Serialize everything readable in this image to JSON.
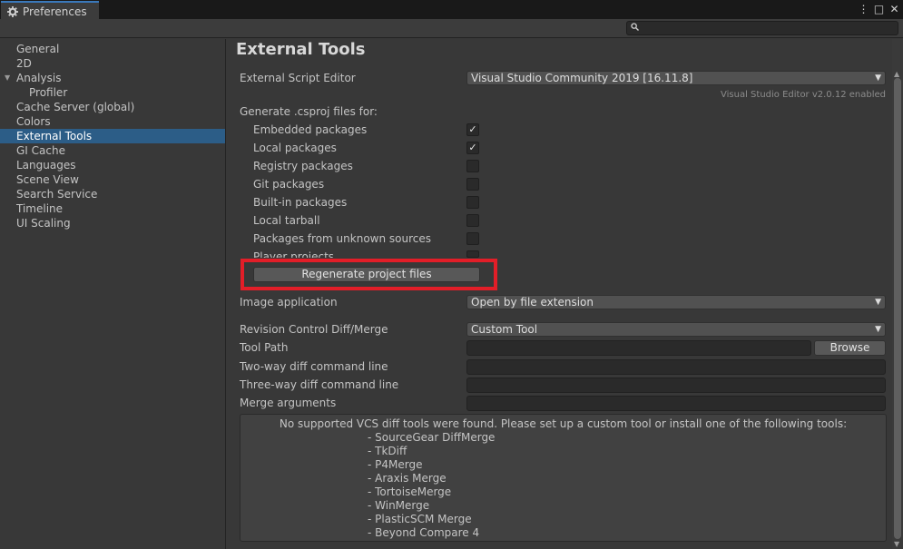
{
  "window": {
    "title": "Preferences",
    "controls": [
      "⋮",
      "□",
      "✕"
    ]
  },
  "search": {
    "placeholder": ""
  },
  "sidebar": {
    "items": [
      {
        "label": "General"
      },
      {
        "label": "2D"
      },
      {
        "label": "Analysis"
      },
      {
        "label": "Profiler"
      },
      {
        "label": "Cache Server (global)"
      },
      {
        "label": "Colors"
      },
      {
        "label": "External Tools"
      },
      {
        "label": "GI Cache"
      },
      {
        "label": "Languages"
      },
      {
        "label": "Scene View"
      },
      {
        "label": "Search Service"
      },
      {
        "label": "Timeline"
      },
      {
        "label": "UI Scaling"
      }
    ],
    "selected": "External Tools"
  },
  "main": {
    "title": "External Tools",
    "script_editor": {
      "label": "External Script Editor",
      "value": "Visual Studio Community 2019 [16.11.8]",
      "hint": "Visual Studio Editor v2.0.12 enabled"
    },
    "csproj": {
      "heading": "Generate .csproj files for:",
      "items": [
        {
          "label": "Embedded packages",
          "checked": true,
          "mark": "✓"
        },
        {
          "label": "Local packages",
          "checked": true,
          "mark": "✓"
        },
        {
          "label": "Registry packages",
          "checked": false,
          "mark": ""
        },
        {
          "label": "Git packages",
          "checked": false,
          "mark": ""
        },
        {
          "label": "Built-in packages",
          "checked": false,
          "mark": ""
        },
        {
          "label": "Local tarball",
          "checked": false,
          "mark": ""
        },
        {
          "label": "Packages from unknown sources",
          "checked": false,
          "mark": ""
        },
        {
          "label": "Player projects",
          "checked": false,
          "mark": ""
        }
      ],
      "regenerate_label": "Regenerate project files"
    },
    "image_app": {
      "label": "Image application",
      "value": "Open by file extension"
    },
    "revision": {
      "label": "Revision Control Diff/Merge",
      "value": "Custom Tool"
    },
    "tool_path": {
      "label": "Tool Path",
      "value": "",
      "browse_label": "Browse"
    },
    "two_way": {
      "label": "Two-way diff command line",
      "value": ""
    },
    "three_way": {
      "label": "Three-way diff command line",
      "value": ""
    },
    "merge_args": {
      "label": "Merge arguments",
      "value": ""
    },
    "info": {
      "message": "No supported VCS diff tools were found. Please set up a custom tool or install one of the following tools:",
      "tools": [
        "- SourceGear DiffMerge",
        "- TkDiff",
        "- P4Merge",
        "- Araxis Merge",
        "- TortoiseMerge",
        "- WinMerge",
        "- PlasticSCM Merge",
        "- Beyond Compare 4"
      ]
    }
  },
  "colors": {
    "selection": "#2c5d87",
    "highlight_box": "#e21e28",
    "tab_accent": "#3a79bb"
  }
}
